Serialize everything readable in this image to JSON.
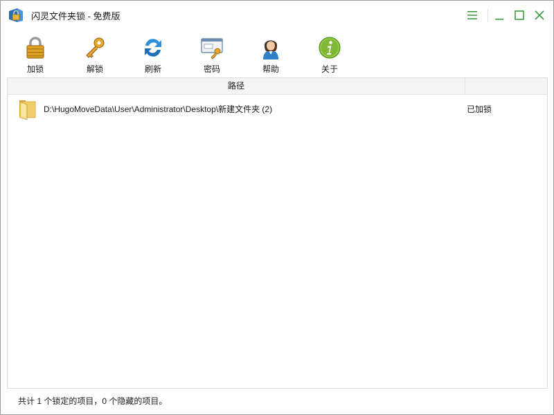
{
  "window": {
    "title": "闪灵文件夹锁 - 免费版",
    "accent_color": "#3c9a3c"
  },
  "window_controls": [
    {
      "name": "menu-button",
      "icon": "hamburger-icon"
    },
    {
      "name": "minimize-button",
      "icon": "minimize-icon"
    },
    {
      "name": "maximize-button",
      "icon": "maximize-icon"
    },
    {
      "name": "close-button",
      "icon": "close-icon"
    }
  ],
  "toolbar": {
    "lock_label": "加锁",
    "unlock_label": "解锁",
    "refresh_label": "刷新",
    "password_label": "密码",
    "help_label": "帮助",
    "about_label": "关于"
  },
  "list": {
    "columns": {
      "path": "路径",
      "status": ""
    },
    "rows": [
      {
        "icon": "folder-icon",
        "path": "D:\\HugoMoveData\\User\\Administrator\\Desktop\\新建文件夹 (2)",
        "status": "已加锁"
      }
    ]
  },
  "statusbar": {
    "text": "共计 1 个锁定的项目，0 个隐藏的项目。"
  }
}
